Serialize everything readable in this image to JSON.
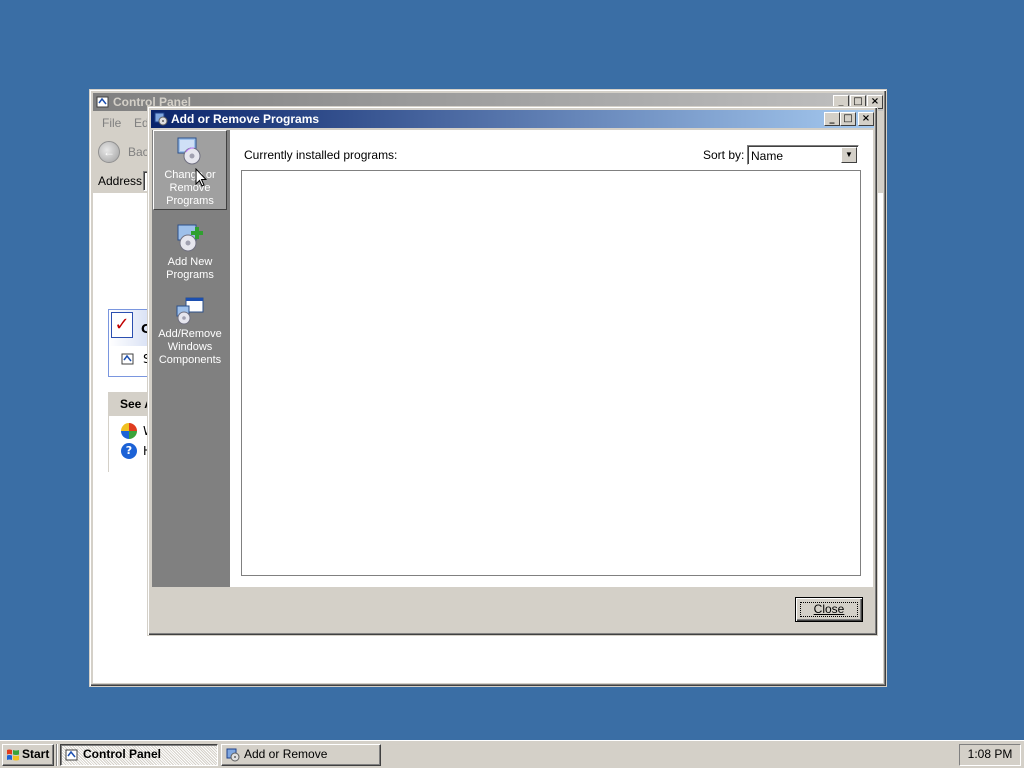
{
  "background_window": {
    "title": "Control Panel",
    "menu": [
      "File",
      "Ed"
    ],
    "toolbar": {
      "back_label": "Back"
    },
    "address_label": "Address",
    "task_pane": {
      "header_text": "Co",
      "item_text": "S"
    },
    "see_also": {
      "header": "See A",
      "items": [
        "W",
        "H"
      ]
    }
  },
  "dialog": {
    "title": "Add or Remove Programs",
    "sidebar": [
      {
        "label_lines": [
          "Change or",
          "Remove",
          "Programs"
        ],
        "icon": "change-remove-programs-icon",
        "selected": true
      },
      {
        "label_lines": [
          "Add New",
          "Programs"
        ],
        "icon": "add-new-programs-icon",
        "selected": false
      },
      {
        "label_lines": [
          "Add/Remove",
          "Windows",
          "Components"
        ],
        "icon": "add-remove-windows-components-icon",
        "selected": false
      }
    ],
    "installed_label": "Currently installed programs:",
    "sort_label": "Sort by:",
    "sort_value": "Name",
    "programs": [],
    "close_label": "Close"
  },
  "taskbar": {
    "start_label": "Start",
    "tasks": [
      {
        "label": "Control Panel",
        "active": true,
        "icon": "control-panel-icon"
      },
      {
        "label": "Add or Remove Programs",
        "active": false,
        "icon": "add-remove-programs-icon"
      }
    ],
    "clock": "1:08 PM"
  },
  "colors": {
    "desktop": "#3a6ea5",
    "active_title_start": "#0a246a",
    "active_title_end": "#a6caf0",
    "inactive_title_start": "#808080",
    "face": "#d4d0c8",
    "sidebar": "#808080"
  }
}
